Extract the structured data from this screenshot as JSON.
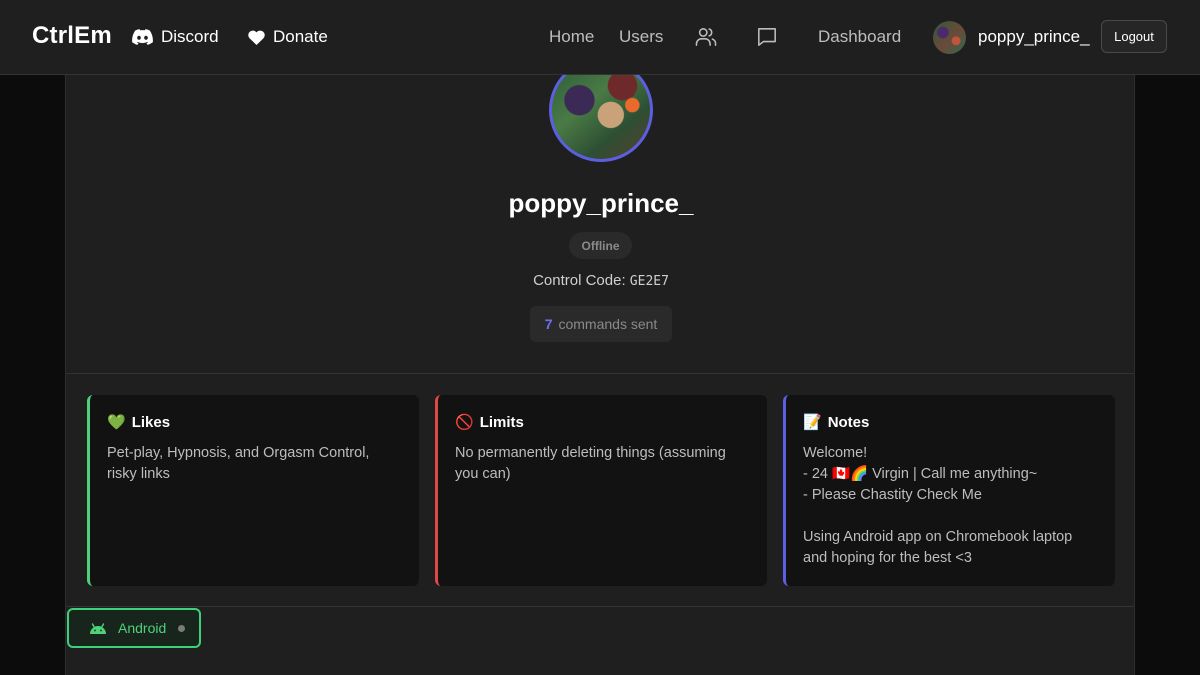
{
  "brand": {
    "name": "CtrlEm"
  },
  "nav": {
    "discord": "Discord",
    "donate": "Donate",
    "home": "Home",
    "users": "Users",
    "dashboard": "Dashboard",
    "friends_icon": "users-icon",
    "messages_icon": "chat-icon"
  },
  "user_menu": {
    "username": "poppy_prince_",
    "logout": "Logout"
  },
  "profile": {
    "username": "poppy_prince_",
    "status": "Offline",
    "control_code_label": "Control Code:",
    "control_code": "GE2E7",
    "commands_count": "7",
    "commands_label": "commands sent"
  },
  "cards": {
    "likes": {
      "icon": "💚",
      "title": "Likes",
      "body": "Pet-play, Hypnosis, and Orgasm Control, risky links"
    },
    "limits": {
      "icon": "🚫",
      "title": "Limits",
      "body": "No permanently deleting things (assuming you can)"
    },
    "notes": {
      "icon": "📝",
      "title": "Notes",
      "body": "Welcome!\n- 24 🇨🇦🌈 Virgin | Call me anything~\n- Please Chastity Check Me\n\nUsing Android app on Chromebook laptop and hoping for the best <3"
    }
  },
  "device": {
    "platform": "Android"
  },
  "colors": {
    "likes_accent": "#4fd17a",
    "limits_accent": "#e04747",
    "notes_accent": "#5b5fe0",
    "commands_count": "#6b72f2",
    "android_green": "#4fd17a"
  }
}
